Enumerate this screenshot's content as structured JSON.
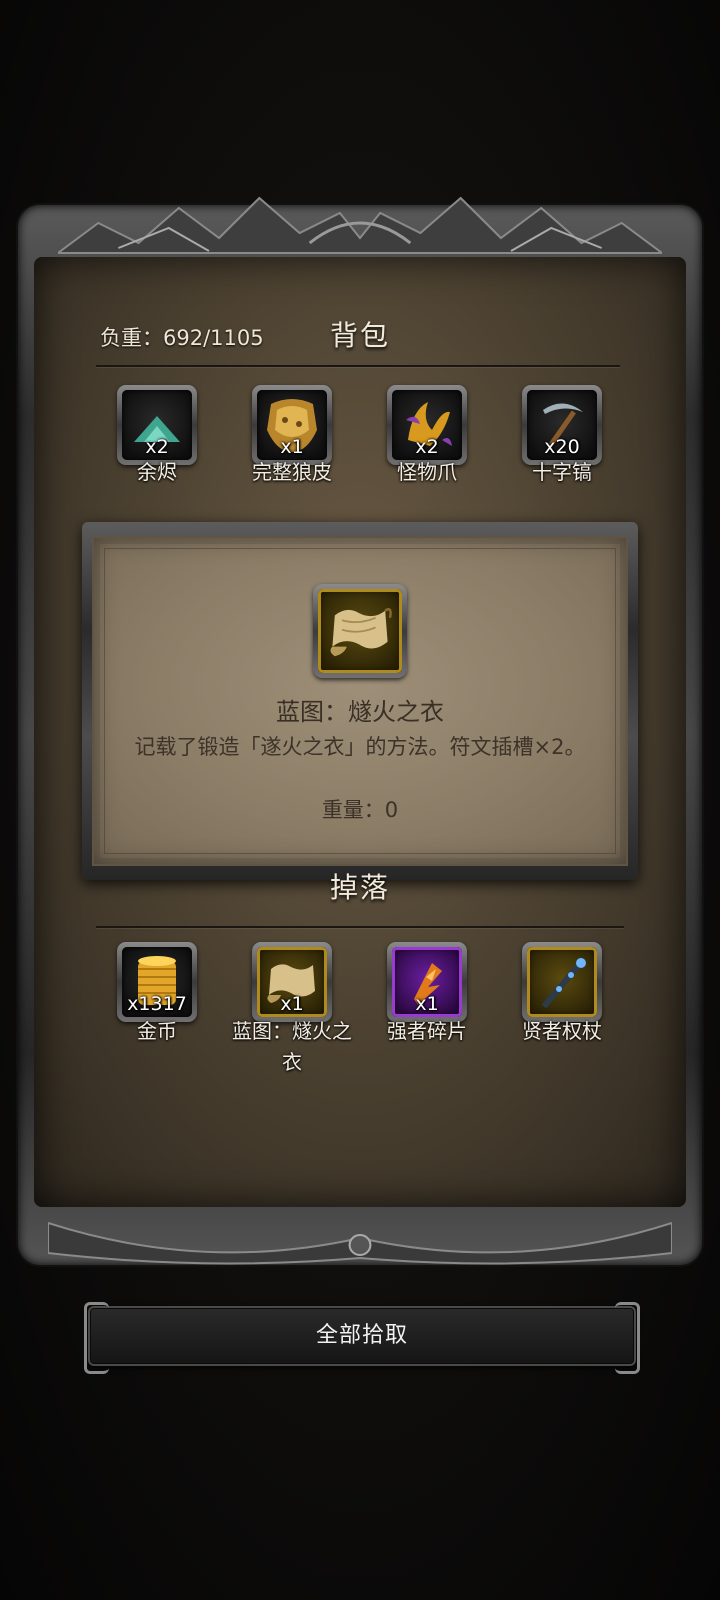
{
  "inventory": {
    "weight_label": "负重：692/1105",
    "title": "背包",
    "items": [
      {
        "name": "余烬",
        "qty": "x2",
        "icon": "ember-icon"
      },
      {
        "name": "完整狼皮",
        "qty": "x1",
        "icon": "wolf-pelt-icon"
      },
      {
        "name": "怪物爪",
        "qty": "x2",
        "icon": "monster-claw-icon"
      },
      {
        "name": "十字镐",
        "qty": "x20",
        "icon": "pickaxe-icon"
      }
    ]
  },
  "tooltip": {
    "icon": "scroll-icon",
    "title": "蓝图：燧火之衣",
    "description": "记载了锻造「遂火之衣」的方法。符文插槽×2。",
    "weight": "重量：0"
  },
  "drops": {
    "title": "掉落",
    "items": [
      {
        "name": "金币",
        "qty": "x1317",
        "icon": "gold-coins-icon"
      },
      {
        "name": "蓝图：燧火之衣",
        "qty": "x1",
        "icon": "scroll-icon"
      },
      {
        "name": "强者碎片",
        "qty": "x1",
        "icon": "shard-icon"
      },
      {
        "name": "贤者权杖",
        "qty": "",
        "icon": "scepter-icon"
      }
    ]
  },
  "actions": {
    "pick_all_label": "全部拾取"
  },
  "colors": {
    "panel_bg": "#4f4433",
    "popup_bg": "#8c7d67",
    "gold_frame": "#b08a1a",
    "purple_frame": "#9b3ad2"
  }
}
